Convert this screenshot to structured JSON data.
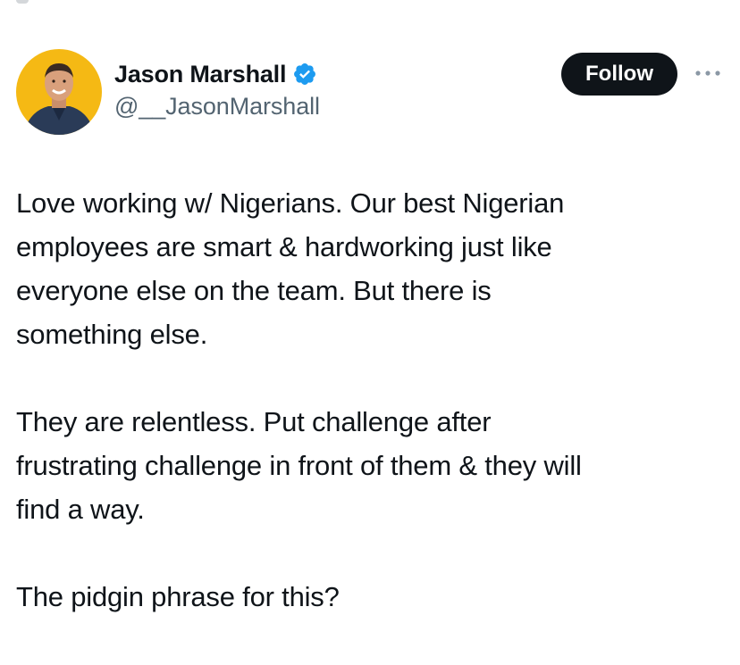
{
  "author": {
    "display_name": "Jason Marshall",
    "handle": "@__JasonMarshall",
    "verified": true,
    "verified_color": "#1d9bf0",
    "avatar_bg_color": "#f5b914"
  },
  "actions": {
    "follow_label": "Follow",
    "more_icon": "ellipsis-icon"
  },
  "tweet": {
    "paragraphs": [
      "Love working w/ Nigerians. Our best Nigerian\nemployees are smart & hardworking just like\neveryone else on the team. But there is\nsomething else.",
      "They are relentless. Put challenge after\nfrustrating challenge in front of them & they will\nfind a way.",
      "The pidgin phrase for this?"
    ]
  }
}
